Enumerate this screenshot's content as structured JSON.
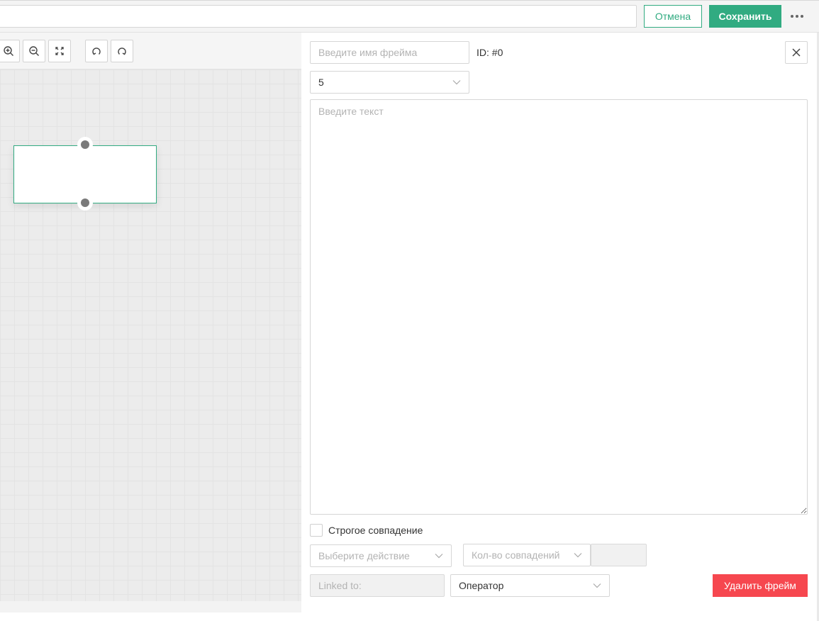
{
  "header": {
    "name_value": "",
    "cancel_label": "Отмена",
    "save_label": "Сохранить"
  },
  "toolbar": {
    "tools": [
      "zoom-in-icon",
      "zoom-out-icon",
      "fit-screen-icon",
      "undo-icon",
      "redo-icon"
    ]
  },
  "frame": {
    "name_placeholder": "Введите имя фрейма",
    "id_label": "ID: #0",
    "type_value": "5",
    "text_placeholder": "Введите текст",
    "strict_match_label": "Строгое совпадение",
    "action_placeholder": "Выберите действие",
    "match_count_placeholder": "Кол-во совпадений",
    "linked_placeholder": "Linked to:",
    "operator_value": "Оператор",
    "delete_label": "Удалить фрейм"
  },
  "colors": {
    "accent": "#31ab81",
    "danger": "#f6474f",
    "port": "#7a7a7a"
  }
}
